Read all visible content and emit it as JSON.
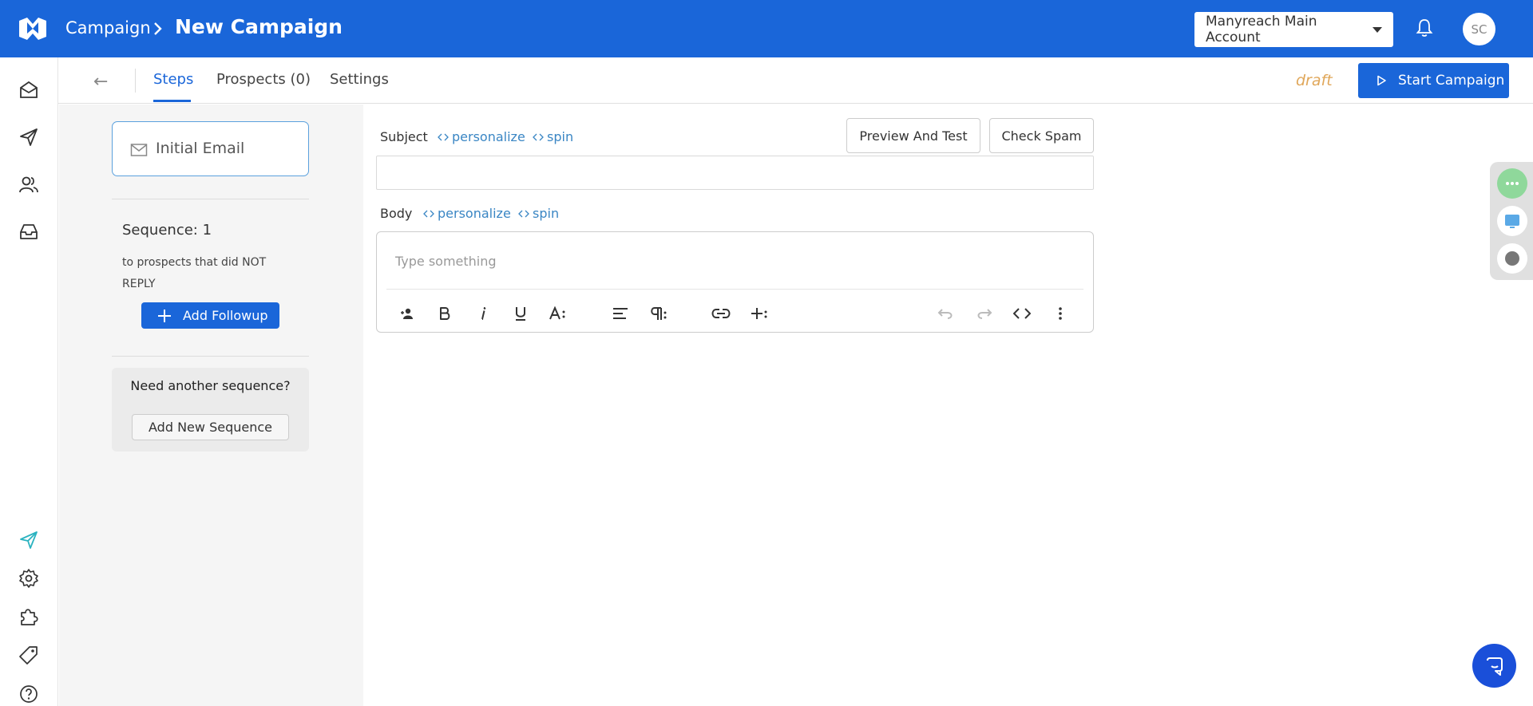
{
  "header": {
    "breadcrumb_root": "Campaign",
    "breadcrumb_current": "New Campaign",
    "account_selector": "Manyreach Main Account",
    "avatar_initials": "SC"
  },
  "tabs": {
    "back_arrow": "←",
    "items": [
      {
        "label": "Steps",
        "active": true
      },
      {
        "label": "Prospects (0)",
        "active": false
      },
      {
        "label": "Settings",
        "active": false
      }
    ]
  },
  "status": "draft",
  "start_button_label": "Start Campaign",
  "sidebar": {
    "step_label": "Initial Email",
    "sequence_title": "Sequence: 1",
    "sequence_desc": "to prospects that did NOT REPLY",
    "add_followup_label": "Add Followup",
    "need_another_title": "Need another sequence?",
    "add_new_sequence_label": "Add New Sequence"
  },
  "editor": {
    "subject_label": "Subject",
    "body_label": "Body",
    "personalize_label": "personalize",
    "spin_label": "spin",
    "preview_label": "Preview And Test",
    "check_spam_label": "Check Spam",
    "body_placeholder": "Type something",
    "toolbar": [
      "personalize-tag",
      "bold",
      "italic",
      "underline",
      "text-size",
      "align",
      "paragraph",
      "link",
      "insert",
      "undo",
      "redo",
      "code-view",
      "more"
    ]
  },
  "colors": {
    "brand_blue": "#1a66d9",
    "link_blue": "#3a86c4",
    "draft_orange": "#e0a75a",
    "active_rail_icon": "#2bb3c0"
  }
}
